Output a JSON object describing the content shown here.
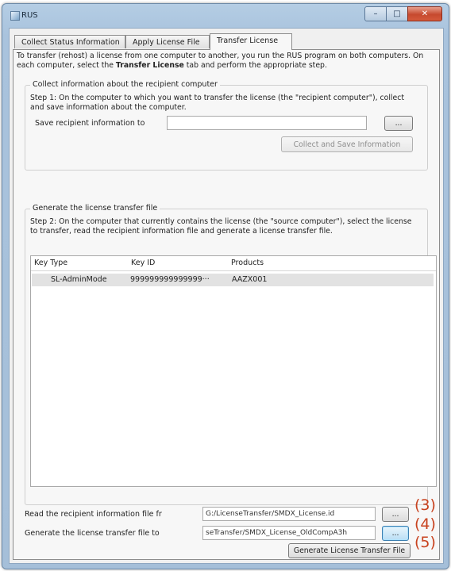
{
  "window": {
    "title": "RUS",
    "controls": {
      "minimize": "–",
      "maximize": "□",
      "close": "✕"
    }
  },
  "tabs": [
    {
      "label": "Collect Status Information",
      "active": false
    },
    {
      "label": "Apply License File",
      "active": false
    },
    {
      "label": "Transfer License",
      "active": true
    }
  ],
  "intro": {
    "text_before": "To transfer (rehost) a license from one computer to another, you run the RUS program on both computers. On each computer, select the ",
    "bold": "Transfer License",
    "text_after": " tab and perform the appropriate step."
  },
  "collect_group": {
    "title": "Collect information about the recipient computer",
    "step": "Step 1: On the computer to which you want to transfer the license (the \"recipient computer\"), collect and save information about the computer.",
    "save_label": "Save recipient information to",
    "save_value": "",
    "browse_label": "...",
    "collect_button": "Collect and Save Information"
  },
  "generate_group": {
    "title": "Generate the license transfer file",
    "step": "Step 2: On the computer that currently contains the license (the \"source computer\"), select the license to transfer, read the recipient information file and generate a license transfer file.",
    "columns": [
      "Key Type",
      "Key ID",
      "Products"
    ],
    "rows": [
      {
        "key_type": "SL-AdminMode",
        "key_id": "999999999999999···",
        "products": "AAZX001"
      }
    ],
    "read_label": "Read the recipient information file fr",
    "read_value": "G:/LicenseTransfer/SMDX_License.id",
    "read_browse": "...",
    "generate_label": "Generate the license transfer file to",
    "generate_value": "seTransfer/SMDX_License_OldCompA3h",
    "generate_browse": "...",
    "generate_button": "Generate License Transfer File"
  },
  "callouts": [
    "(3)",
    "(4)",
    "(5)"
  ],
  "colors": {
    "callout": "#c8421f",
    "titlebar": "#a9c3dd",
    "close_button": "#c6492e"
  }
}
